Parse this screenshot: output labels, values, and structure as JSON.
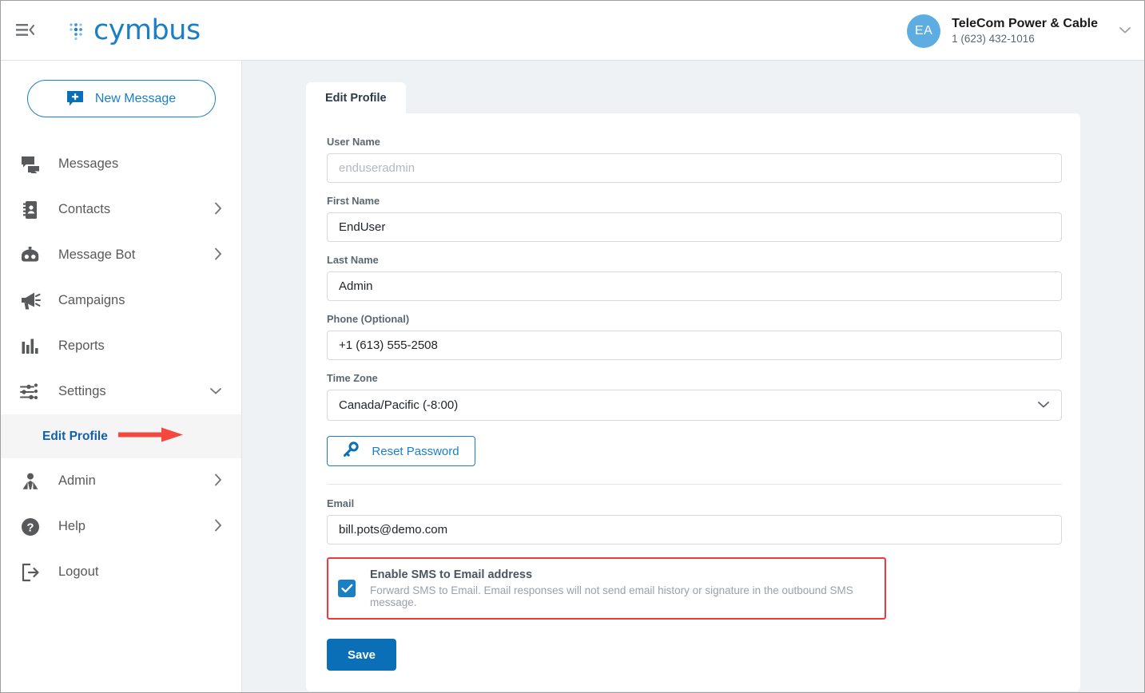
{
  "header": {
    "collapse_icon": "menu-collapse-icon",
    "logo_text": "cymbus",
    "logo_color": "#1b7fc4",
    "account": {
      "avatar_initials": "EA",
      "name": "TeleCom Power & Cable",
      "phone": "1 (623) 432-1016",
      "caret_icon": "chevron-down-icon"
    }
  },
  "sidebar": {
    "new_message": {
      "label": "New Message",
      "icon": "new-message-icon"
    },
    "items": [
      {
        "label": "Messages",
        "icon": "messages-icon",
        "arrow": "",
        "active": false
      },
      {
        "label": "Contacts",
        "icon": "contacts-icon",
        "arrow": "›",
        "active": false
      },
      {
        "label": "Message Bot",
        "icon": "robot-icon",
        "arrow": "›",
        "active": false
      },
      {
        "label": "Campaigns",
        "icon": "megaphone-icon",
        "arrow": "",
        "active": false
      },
      {
        "label": "Reports",
        "icon": "bar-chart-icon",
        "arrow": "",
        "active": false
      },
      {
        "label": "Settings",
        "icon": "sliders-icon",
        "arrow": "⌄",
        "active": true
      }
    ],
    "subitem": {
      "label": "Edit Profile",
      "annotation": "red-arrow-pointer"
    },
    "items_after": [
      {
        "label": "Admin",
        "icon": "user-tie-icon",
        "arrow": "›"
      },
      {
        "label": "Help",
        "icon": "question-circle-icon",
        "arrow": "›"
      },
      {
        "label": "Logout",
        "icon": "logout-icon",
        "arrow": ""
      }
    ]
  },
  "main": {
    "tab": {
      "label": "Edit Profile"
    },
    "fields": [
      {
        "label": "User Name",
        "value": "",
        "placeholder": "enduseradmin",
        "type": "text"
      },
      {
        "label": "First Name",
        "value": "EndUser",
        "placeholder": "",
        "type": "text"
      },
      {
        "label": "Last Name",
        "value": "Admin",
        "placeholder": "",
        "type": "text"
      },
      {
        "label": "Phone (Optional)",
        "value": "+1 (613) 555-2508",
        "placeholder": "",
        "type": "text"
      }
    ],
    "timezone": {
      "label": "Time Zone",
      "value": "Canada/Pacific (-8:00)",
      "caret_icon": "chevron-down-icon"
    },
    "reset_password": {
      "label": "Reset Password",
      "icon": "key-icon"
    },
    "email": {
      "label": "Email",
      "value": "bill.pots@demo.com",
      "placeholder": ""
    },
    "sms_to_email": {
      "checked": true,
      "title": "Enable SMS to Email address",
      "description": "Forward SMS to Email. Email responses will not send email history or signature in the outbound SMS message.",
      "highlight_color": "#f03a3a"
    },
    "save": {
      "label": "Save"
    }
  },
  "colors": {
    "brand_blue": "#1b7fc4",
    "save_blue": "#0a6fb7",
    "content_bg": "#eef2f5",
    "annotation_red": "#f03a3a",
    "link_blue": "#1360a8"
  }
}
